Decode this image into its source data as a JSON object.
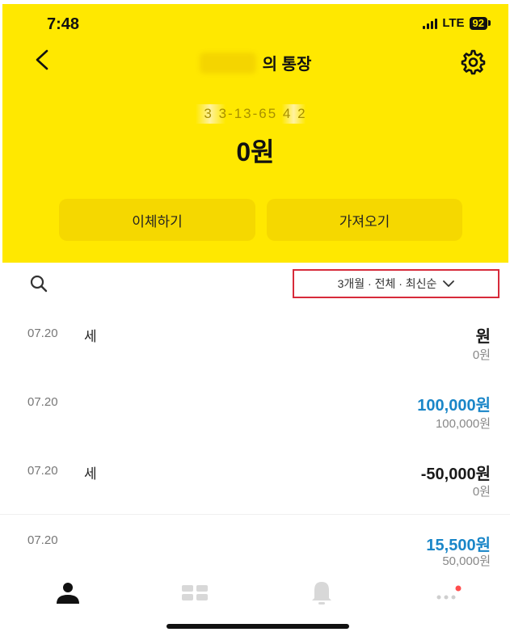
{
  "status_bar": {
    "time": "7:48",
    "network": "LTE",
    "battery": "92"
  },
  "header": {
    "title": "의 통장",
    "account_number": "3  3-13-65    4  2",
    "balance": "0원"
  },
  "actions": {
    "transfer_label": "이체하기",
    "bring_label": "가져오기"
  },
  "filter": {
    "label": "3개월 · 전체 · 최신순"
  },
  "transactions": [
    {
      "date": "07.20",
      "description": "세",
      "amount": "원",
      "balance": "0원"
    },
    {
      "date": "07.20",
      "description": "",
      "amount": "100,000원",
      "balance": "100,000원"
    },
    {
      "date": "07.20",
      "description": "세",
      "amount": "-50,000원",
      "balance": "0원"
    },
    {
      "date": "07.20",
      "description": "",
      "amount": "15,500원",
      "balance": "50,000원"
    }
  ],
  "tabbar": {
    "icons": [
      "person-icon",
      "grid-icon",
      "bell-icon",
      "more-icon"
    ]
  },
  "colors": {
    "header_bg": "#ffe800",
    "button_bg": "#f5d800",
    "deposit_blue": "#1a86c8",
    "filter_border": "#d72a3a",
    "badge_red": "#ff4d4d"
  }
}
